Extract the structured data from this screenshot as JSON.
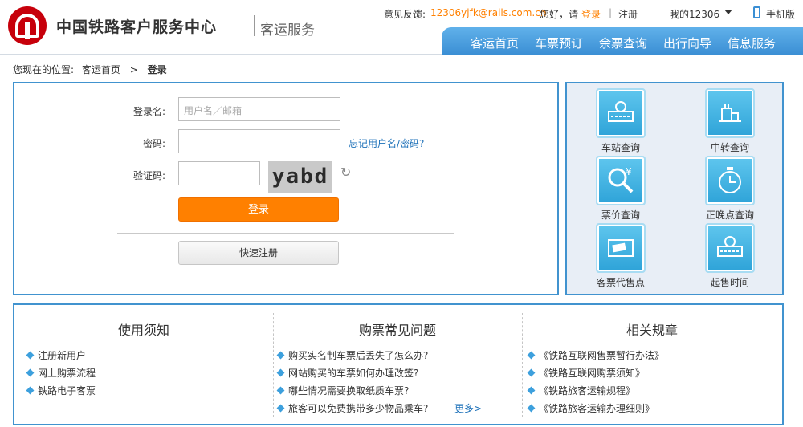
{
  "header": {
    "site_name": "中国铁路客户服务中心",
    "site_sub": "客运服务",
    "feedback_label": "意见反馈:",
    "feedback_email": "12306yjfk@rails.com.cn",
    "greeting": "您好，请",
    "login_link": "登录",
    "divider": "|",
    "register_link": "注册",
    "my_account": "我的12306",
    "mobile": "手机版"
  },
  "nav": [
    "客运首页",
    "车票预订",
    "余票查询",
    "出行向导",
    "信息服务"
  ],
  "breadcrumb": {
    "prefix": "您现在的位置:",
    "home": "客运首页",
    "sep": ">",
    "current": "登录"
  },
  "login": {
    "username_label": "登录名:",
    "username_placeholder": "用户名／邮箱",
    "password_label": "密码:",
    "forgot_link": "忘记用户名/密码?",
    "captcha_label": "验证码:",
    "captcha_text": "yabd",
    "login_button": "登录",
    "register_button": "快速注册"
  },
  "quick_links": [
    "车站查询",
    "中转查询",
    "票价查询",
    "正晚点查询",
    "客票代售点",
    "起售时间"
  ],
  "info": {
    "col1_title": "使用须知",
    "col1_items": [
      "注册新用户",
      "网上购票流程",
      "铁路电子客票"
    ],
    "col2_title": "购票常见问题",
    "col2_items": [
      "购买实名制车票后丢失了怎么办?",
      "网站购买的车票如何办理改签?",
      "哪些情况需要换取纸质车票?",
      "旅客可以免费携带多少物品乘车?"
    ],
    "col2_more": "更多>",
    "col3_title": "相关规章",
    "col3_items": [
      "《铁路互联网售票暂行办法》",
      "《铁路互联网购票须知》",
      "《铁路旅客运输规程》",
      "《铁路旅客运输办理细则》"
    ]
  },
  "colors": {
    "accent": "#4193cf",
    "orange": "#ff8000",
    "link": "#1a6fb8"
  }
}
